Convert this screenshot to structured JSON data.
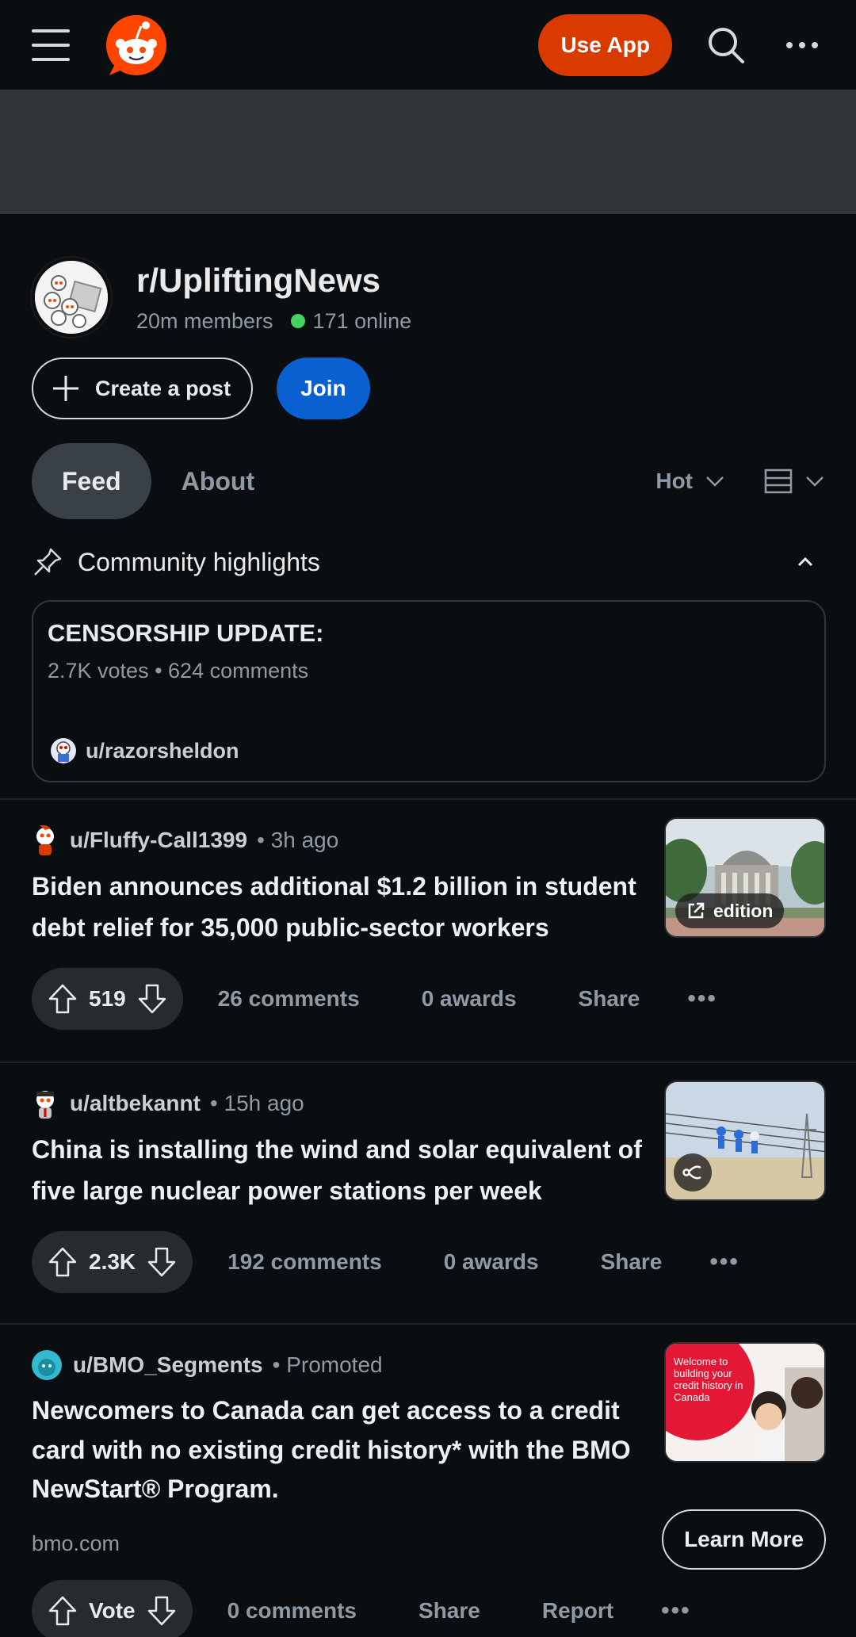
{
  "header": {
    "use_app_label": "Use App"
  },
  "community": {
    "name": "r/UpliftingNews",
    "members": "20m members",
    "online": "171 online",
    "create_post_label": "Create a post",
    "join_label": "Join"
  },
  "tabs": [
    {
      "label": "Feed",
      "active": true
    },
    {
      "label": "About",
      "active": false
    }
  ],
  "sort": {
    "label": "Hot"
  },
  "highlights": {
    "label": "Community highlights",
    "card": {
      "title": "CENSORSHIP UPDATE:",
      "meta": "2.7K votes • 624 comments",
      "user": "u/razorsheldon"
    }
  },
  "posts": [
    {
      "user": "u/Fluffy-Call1399",
      "time": "• 3h ago",
      "title": "Biden announces additional $1.2 billion in student debt relief for 35,000 public-sector workers",
      "thumb_badge": "edition",
      "votes": "519",
      "comments": "26 comments",
      "awards": "0 awards",
      "share": "Share"
    },
    {
      "user": "u/altbekannt",
      "time": "• 15h ago",
      "title": "China is installing the wind and solar equivalent of five large nuclear power stations per week",
      "votes": "2.3K",
      "comments": "192 comments",
      "awards": "0 awards",
      "share": "Share"
    },
    {
      "user": "u/BMO_Segments",
      "time": "• Promoted",
      "title": "Newcomers to Canada can get access to a credit card with no existing credit history* with the BMO NewStart® Program.",
      "thumb_text": "Welcome to building your credit history in Canada",
      "domain": "bmo.com",
      "cta": "Learn More",
      "votes": "Vote",
      "comments": "0 comments",
      "share": "Share",
      "report": "Report"
    }
  ],
  "colors": {
    "accent_orange": "#d93a00",
    "join_blue": "#0a5fd1",
    "online_green": "#46d160",
    "background": "#0b0e11"
  }
}
